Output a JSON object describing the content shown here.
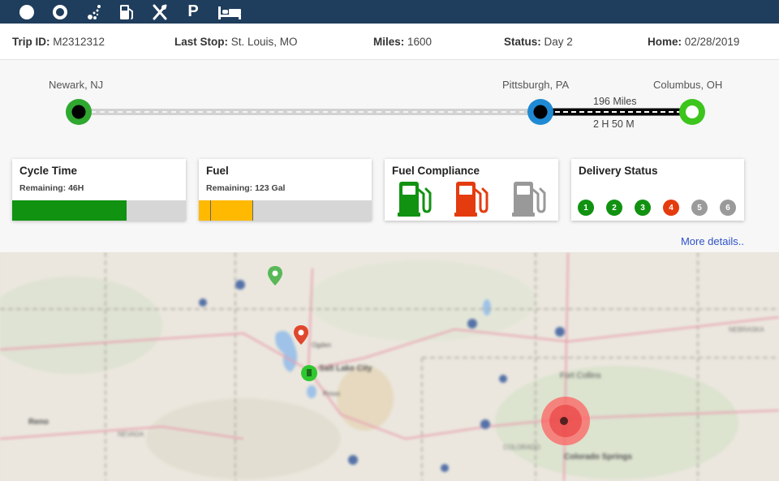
{
  "toolbar": {
    "icons": [
      "dot-icon",
      "ring-icon",
      "location-scatter-icon",
      "fuel-station-icon",
      "restaurant-icon",
      "parking-icon",
      "bed-icon"
    ],
    "parking_letter": "P",
    "color": "#1f3d5c"
  },
  "info": {
    "trip_label": "Trip ID:",
    "trip_value": "M2312312",
    "last_stop_label": "Last Stop:",
    "last_stop_value": "St. Louis, MO",
    "miles_label": "Miles:",
    "miles_value": "1600",
    "status_label": "Status:",
    "status_value": "Day 2",
    "home_label": "Home:",
    "home_value": "02/28/2019"
  },
  "route": {
    "origin": "Newark, NJ",
    "current": "Pittsburgh, PA",
    "destination": "Columbus, OH",
    "segment_miles": "196 Miles",
    "segment_time": "2 H 50 M",
    "colors": {
      "origin": "#2fa82f",
      "current": "#1f8ad3",
      "destination": "#3cc51c"
    }
  },
  "cards": {
    "cycle": {
      "title": "Cycle Time",
      "remaining": "Remaining: 46H",
      "level_pct": 66,
      "color": "#119211"
    },
    "fuel": {
      "title": "Fuel",
      "remaining": "Remaining: 123 Gal",
      "level_pct": 31,
      "color": "#ffb900"
    },
    "compliance": {
      "title": "Fuel Compliance",
      "pump_colors": [
        "#119211",
        "#e43c0f",
        "#999999"
      ]
    },
    "delivery": {
      "title": "Delivery Status",
      "stops": [
        {
          "n": "1",
          "color": "#119211"
        },
        {
          "n": "2",
          "color": "#119211"
        },
        {
          "n": "3",
          "color": "#119211"
        },
        {
          "n": "4",
          "color": "#e43c0f"
        },
        {
          "n": "5",
          "color": "#9a9a9a"
        },
        {
          "n": "6",
          "color": "#9a9a9a"
        }
      ]
    }
  },
  "more_details": "More details..",
  "map": {
    "labels": [
      "Salt Lake City",
      "Colorado Springs",
      "Fort Collins",
      "Reno",
      "NEVADA",
      "COLORADO",
      "NEBRASKA",
      "Provo",
      "Ogden"
    ]
  }
}
